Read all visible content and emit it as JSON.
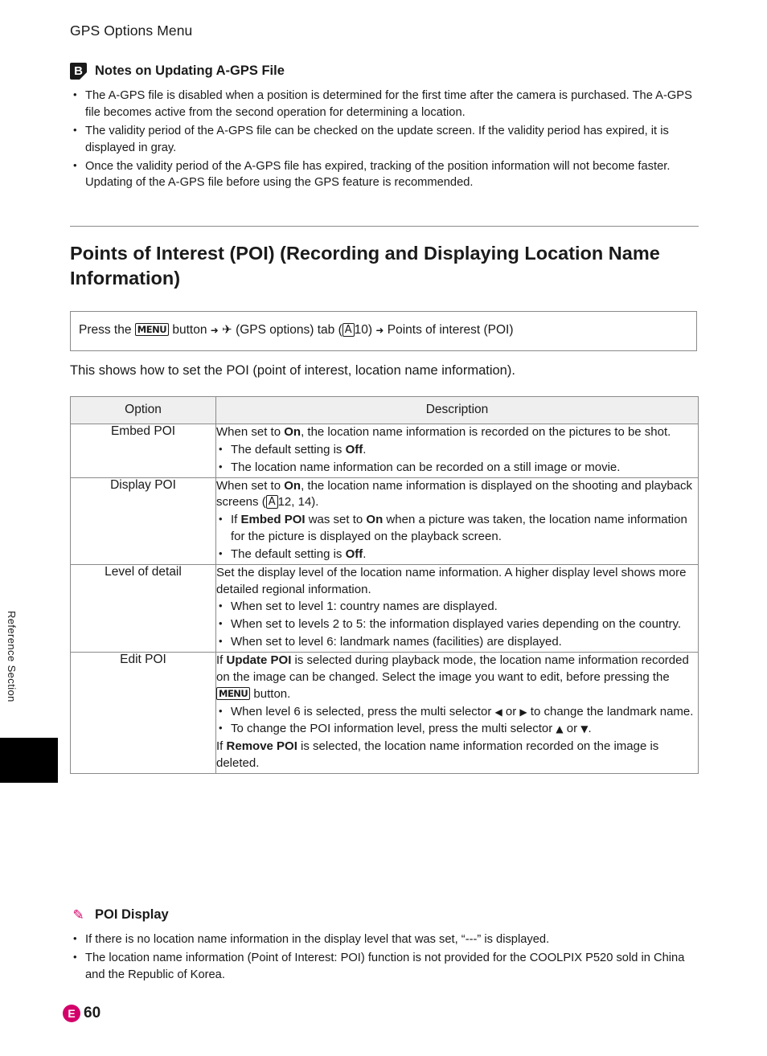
{
  "header": {
    "title": "GPS Options Menu"
  },
  "side": {
    "label": "Reference Section"
  },
  "note_agps": {
    "icon": "caution-icon",
    "title": "Notes on Updating A-GPS File",
    "bullets": [
      "The A-GPS file is disabled when a position is determined for the first time after the camera is purchased. The A-GPS file becomes active from the second operation for determining a location.",
      "The validity period of the A-GPS file can be checked on the update screen. If the validity period has expired, it is displayed in gray.",
      "Once the validity period of the A-GPS file has expired, tracking of the position information will not become faster. Updating of the A-GPS file before using the GPS feature is recommended."
    ]
  },
  "section": {
    "title": "Points of Interest (POI) (Recording and Displaying Location Name Information)"
  },
  "press_path": {
    "prefix": "Press the",
    "menu_glyph": "MENU",
    "after_menu": "button",
    "arrow": "➜",
    "gps_glyph": "✈",
    "gps_label": "(GPS options) tab (",
    "cam_glyph": "A",
    "page_ref": "10)",
    "final": "Points of interest (POI)"
  },
  "intro": "This shows how to set the POI (point of interest, location name information).",
  "table": {
    "headers": [
      "Option",
      "Description"
    ],
    "rows": [
      {
        "option": "Embed POI",
        "lead": "When set to On, the location name information is recorded on the pictures to be shot.",
        "bullets": [
          "The default setting is Off.",
          "The location name information can be recorded on a still image or movie."
        ]
      },
      {
        "option": "Display POI",
        "lead": "When set to On, the location name information is displayed on the shooting and playback screens (A12, 14).",
        "bullets": [
          "If Embed POI was set to On when a picture was taken, the location name information for the picture is displayed on the playback screen.",
          "The default setting is Off."
        ]
      },
      {
        "option": "Level of detail",
        "lead": "Set the display level of the location name information. A higher display level shows more detailed regional information.",
        "bullets": [
          "When set to level 1: country names are displayed.",
          "When set to levels 2 to 5: the information displayed varies depending on the country.",
          "When set to level 6: landmark names (facilities) are displayed."
        ]
      },
      {
        "option": "Edit POI",
        "lead": "If Update POI is selected during playback mode, the location name information recorded on the image can be changed. Select the image you want to edit, before pressing the MENU button.",
        "bullets": [
          "When level 6 is selected, press the multi selector ◀ or ▶ to change the landmark name.",
          "To change the POI information level, press the multi selector ▲ or ▼."
        ],
        "tail": "If Remove POI is selected, the location name information recorded on the image is deleted."
      }
    ]
  },
  "note_poi": {
    "icon": "pencil-icon",
    "title": "POI Display",
    "bullets": [
      "If there is no location name information in the display level that was set, “---” is displayed.",
      "The location name information (Point of Interest: POI) function is not provided for the COOLPIX P520 sold in China and the Republic of Korea."
    ]
  },
  "footer": {
    "badge": "E",
    "page": "60"
  },
  "colors": {
    "accent": "#d4006a",
    "rule": "#8a8a8a",
    "header_fill": "#efefef"
  }
}
